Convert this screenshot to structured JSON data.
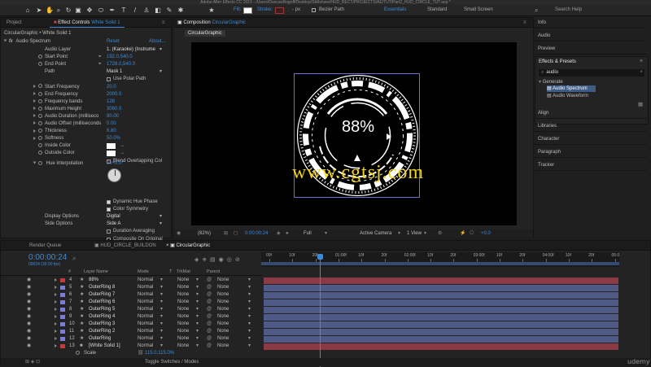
{
  "window_title": "Adobe After Effects CC 2015 - /Users/DuncanRogoff/Desktop/Skillshare/HUD_RECT/PROJECTS/AE/TUT/Part2_HUD_CIRCLE_TUT.aep *",
  "toolbar": {
    "fill_label": "Fill:",
    "stroke_label": "Stroke:",
    "stroke_px": "- px",
    "bezier_label": "Bezier Path",
    "workspaces": [
      "Essentials",
      "Standard",
      "Small Screen"
    ],
    "search_placeholder": "Search Help"
  },
  "left_panel": {
    "tab_project": "Project",
    "tab_effect_controls": "Effect Controls",
    "tab_effect_layer": "White Solid 1",
    "breadcrumb": "CircularGraphic • White Solid 1",
    "effect_name": "Audio Spectrum",
    "reset_label": "Reset",
    "about_label": "About...",
    "props": [
      {
        "name": "Audio Layer",
        "value": "1. (Karaoke) (Instrume",
        "dropdown": true
      },
      {
        "name": "Start Point",
        "value": "192.0,540.0",
        "crosshair": true,
        "stopwatch": true
      },
      {
        "name": "End Point",
        "value": "1728.0,540.0",
        "crosshair": true,
        "stopwatch": true
      },
      {
        "name": "Path",
        "value": "Mask 1",
        "dropdown": true
      },
      {
        "name": "",
        "value": "Use Polar Path",
        "checkbox": true
      },
      {
        "name": "Start Frequency",
        "value": "20.0",
        "twirl": true,
        "stopwatch": true
      },
      {
        "name": "End Frequency",
        "value": "2000.0",
        "twirl": true,
        "stopwatch": true
      },
      {
        "name": "Frequency bands",
        "value": "128",
        "twirl": true,
        "stopwatch": true
      },
      {
        "name": "Maximum Height",
        "value": "3080.0",
        "twirl": true,
        "stopwatch": true
      },
      {
        "name": "Audio Duration (milliseco",
        "value": "90.00",
        "twirl": true,
        "stopwatch": true
      },
      {
        "name": "Audio Offset (milliseconds",
        "value": "0.00",
        "twirl": true,
        "stopwatch": true
      },
      {
        "name": "Thickness",
        "value": "6.80",
        "twirl": true,
        "stopwatch": true
      },
      {
        "name": "Softness",
        "value": "50.0%",
        "twirl": true,
        "stopwatch": true
      },
      {
        "name": "Inside Color",
        "value": "",
        "swatch": true,
        "stopwatch": true
      },
      {
        "name": "Outside Color",
        "value": "",
        "swatch": true,
        "stopwatch": true
      },
      {
        "name": "",
        "value": "Blend Overlapping Col",
        "checkbox": true
      }
    ],
    "hue_label": "Hue Interpolation",
    "hue_value": "0x+0.0°",
    "props2": [
      {
        "name": "",
        "value": "Dynamic Hue Phase",
        "checkbox": true,
        "checked": true
      },
      {
        "name": "",
        "value": "Color Symmetry",
        "checkbox": true,
        "checked": true
      },
      {
        "name": "Display Options",
        "value": "Digital",
        "dropdown": true
      },
      {
        "name": "Side Options",
        "value": "Side A",
        "dropdown": true
      },
      {
        "name": "",
        "value": "Duration Averaging",
        "checkbox": true
      },
      {
        "name": "",
        "value": "Composite On Original",
        "checkbox": true
      }
    ]
  },
  "composition": {
    "tab_label": "Composition",
    "comp_name": "CircularGraphic",
    "subtab": "CircularGraphic",
    "percent_text": "88%",
    "watermark": "www.cgtsj.com",
    "footer": {
      "zoom": "(82%)",
      "timecode": "0:00:00:24",
      "resolution": "Full",
      "camera": "Active Camera",
      "views": "1 View",
      "exposure": "+0.0"
    }
  },
  "right_panel": {
    "items_top": [
      "Info",
      "Audio",
      "Preview"
    ],
    "effects_title": "Effects & Presets",
    "search_value": "audio",
    "generate_label": "Generate",
    "generate_items": [
      "Audio Spectrum",
      "Audio Waveform"
    ],
    "items_bottom": [
      "Align",
      "Libraries",
      "Character",
      "Paragraph",
      "Tracker"
    ]
  },
  "timeline": {
    "tabs": [
      "Render Queue",
      "HUD_CIRCLE_BUILDON",
      "CircularGraphic"
    ],
    "current_time": "0:00:00:24",
    "frame_info": "00024 (30.00 fps)",
    "col_headers": {
      "num": "#",
      "name": "Layer Name",
      "mode": "Mode",
      "t": "T",
      "trkmat": "TrkMat",
      "parent": "Parent"
    },
    "ruler_labels": [
      "00f",
      "10f",
      "20f",
      "01:00f",
      "10f",
      "20f",
      "02:00f",
      "10f",
      "20f",
      "03:00f",
      "10f",
      "20f",
      "04:00f",
      "10f",
      "20f",
      "05:0"
    ],
    "layers": [
      {
        "num": "4",
        "name": "88%",
        "color": "#c8393d",
        "mode": "Normal",
        "trkmat": "None",
        "parent": "None"
      },
      {
        "num": "5",
        "name": "OuterRing 8",
        "color": "#7b7bd8",
        "mode": "Normal",
        "trkmat": "None",
        "parent": "None"
      },
      {
        "num": "6",
        "name": "OuterRing 7",
        "color": "#7b7bd8",
        "mode": "Normal",
        "trkmat": "None",
        "parent": "None"
      },
      {
        "num": "7",
        "name": "OuterRing 6",
        "color": "#7b7bd8",
        "mode": "Normal",
        "trkmat": "None",
        "parent": "None"
      },
      {
        "num": "8",
        "name": "OuterRing 5",
        "color": "#7b7bd8",
        "mode": "Normal",
        "trkmat": "None",
        "parent": "None"
      },
      {
        "num": "9",
        "name": "OuterRing 4",
        "color": "#7b7bd8",
        "mode": "Normal",
        "trkmat": "None",
        "parent": "None"
      },
      {
        "num": "10",
        "name": "OuterRing 3",
        "color": "#7b7bd8",
        "mode": "Normal",
        "trkmat": "None",
        "parent": "None"
      },
      {
        "num": "11",
        "name": "OuterRing 2",
        "color": "#7b7bd8",
        "mode": "Normal",
        "trkmat": "None",
        "parent": "None"
      },
      {
        "num": "12",
        "name": "OuterRing",
        "color": "#7b7bd8",
        "mode": "Normal",
        "trkmat": "None",
        "parent": "None"
      },
      {
        "num": "13",
        "name": "[White Solid 1]",
        "color": "#c8393d",
        "mode": "Normal",
        "trkmat": "None",
        "parent": "None"
      }
    ],
    "scale_label": "Scale",
    "scale_value": "115.0,115.0%",
    "toggle_label": "Toggle Switches / Modes"
  },
  "colors": {
    "accent": "#3d8bd7",
    "ring": "#7b7bd8",
    "red_label": "#c8393d",
    "bar": "#4f5a86"
  },
  "brand": "udemy"
}
